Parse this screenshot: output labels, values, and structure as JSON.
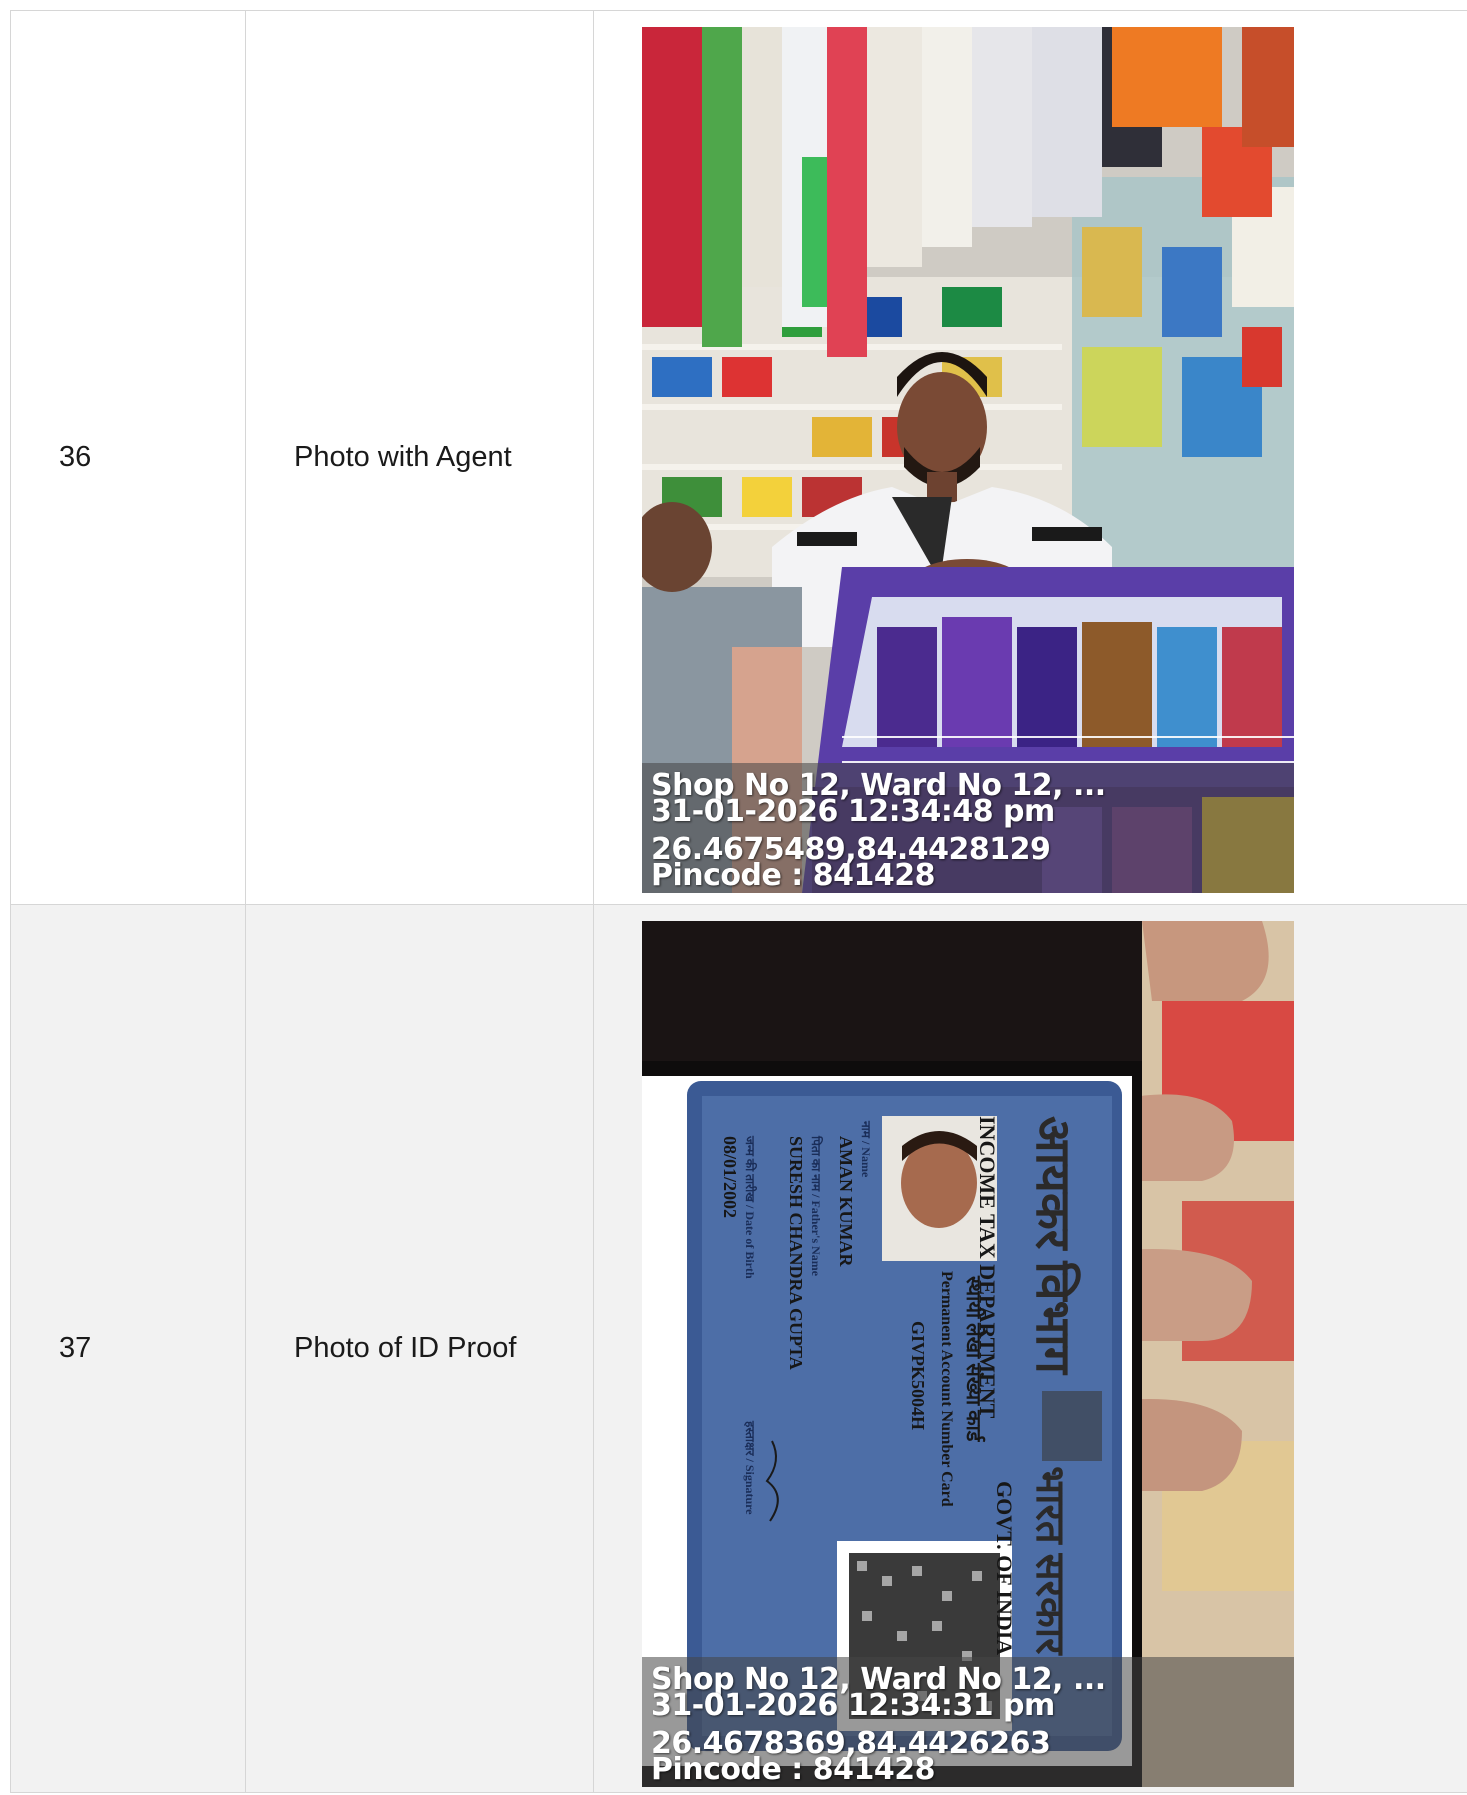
{
  "rows": [
    {
      "number": "36",
      "label": "Photo with Agent",
      "stamp": {
        "address": "Shop No 12, Ward No 12, ...",
        "datetime": "31-01-2026 12:34:48 pm",
        "coords": "26.4675489,84.4428129",
        "pincode": "Pincode : 841428"
      }
    },
    {
      "number": "37",
      "label": "Photo of ID Proof",
      "stamp": {
        "address": "Shop No 12, Ward No 12, ...",
        "datetime": "31-01-2026 12:34:31 pm",
        "coords": "26.4678369,84.4426263",
        "pincode": "Pincode : 841428"
      },
      "card": {
        "dept_hindi": "आयकर विभाग",
        "dept_english": "INCOME TAX DEPARTMENT",
        "govt_hindi": "भारत सरकार",
        "govt_english": "GOVT. OF INDIA",
        "card_type_hindi": "स्थायी लेखा संख्या कार्ड",
        "card_type_english": "Permanent Account Number Card",
        "pan": "GIVPK5004H",
        "name_label": "नाम / Name",
        "name": "AMAN KUMAR",
        "father_label": "पिता का नाम / Father's Name",
        "father_name": "SURESH CHANDRA GUPTA",
        "dob_label": "जन्म की तारीख / Date of Birth",
        "dob": "08/01/2002",
        "signature_label": "हस्ताक्षर / Signature"
      }
    }
  ]
}
